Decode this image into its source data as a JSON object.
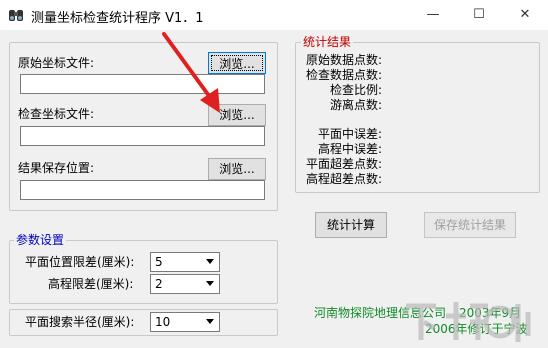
{
  "window": {
    "title": "测量坐标检查统计程序 V1．1",
    "minimize_symbol": "—",
    "maximize_symbol": "☐",
    "close_symbol": "✕"
  },
  "files": {
    "original_label": "原始坐标文件:",
    "original_value": "",
    "check_label": "检查坐标文件:",
    "check_value": "",
    "result_label": "结果保存位置:",
    "result_value": "",
    "browse_label": "浏览..."
  },
  "results": {
    "title": "统计结果",
    "items": [
      "原始数据点数:",
      "检查数据点数:",
      "检查比例:",
      "游离点数:",
      "平面中误差:",
      "高程中误差:",
      "平面超差点数:",
      "高程超差点数:"
    ]
  },
  "actions": {
    "compute_label": "统计计算",
    "save_label": "保存统计结果"
  },
  "params": {
    "title": "参数设置",
    "plane_tol_label": "平面位置限差(厘米):",
    "plane_tol_value": "5",
    "height_tol_label": "高程限差(厘米):",
    "height_tol_value": "2",
    "search_radius_label": "平面搜索半径(厘米):",
    "search_radius_value": "10"
  },
  "credits": {
    "company": "河南物探院地理信息公司",
    "date1": "2003年9月",
    "revision": "2006年修订于宁波"
  },
  "colors": {
    "group_title": "#c00000",
    "credit": "#108a28",
    "arrow": "#e02020"
  },
  "watermark": "下载吧"
}
